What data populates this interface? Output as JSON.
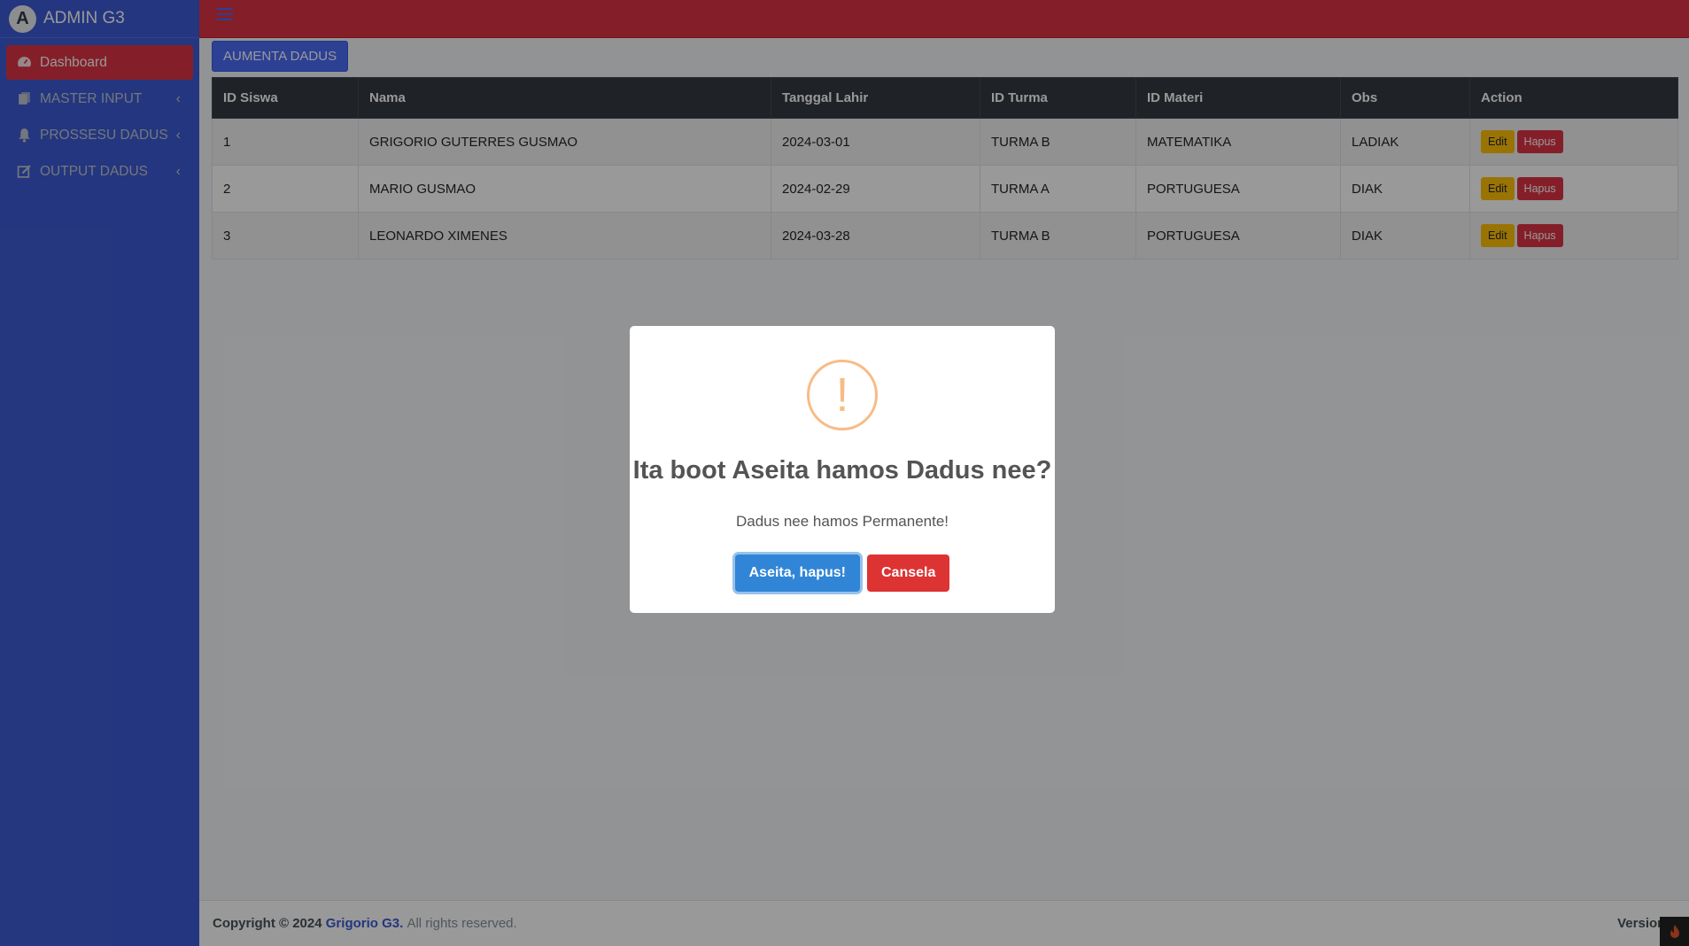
{
  "brand": {
    "title": "ADMIN G3",
    "logo_letter": "A"
  },
  "sidebar": {
    "items": [
      {
        "label": "Dashboard",
        "icon": "tachometer-icon"
      },
      {
        "label": "MASTER INPUT",
        "icon": "copy-icon",
        "chevron": "‹"
      },
      {
        "label": "PROSSESU DADUS",
        "icon": "bell-icon",
        "chevron": "‹"
      },
      {
        "label": "OUTPUT DADUS",
        "icon": "edit-icon",
        "chevron": "‹"
      }
    ]
  },
  "toolbar": {
    "add_label": "AUMENTA DADUS"
  },
  "table": {
    "headers": [
      "ID Siswa",
      "Nama",
      "Tanggal Lahir",
      "ID Turma",
      "ID Materi",
      "Obs",
      "Action"
    ],
    "rows": [
      [
        "1",
        "GRIGORIO GUTERRES GUSMAO",
        "2024-03-01",
        "TURMA B",
        "MATEMATIKA",
        "LADIAK"
      ],
      [
        "2",
        "MARIO GUSMAO",
        "2024-02-29",
        "TURMA A",
        "PORTUGUESA",
        "DIAK"
      ],
      [
        "3",
        "LEONARDO XIMENES",
        "2024-03-28",
        "TURMA B",
        "PORTUGUESA",
        "DIAK"
      ]
    ],
    "edit_label": "Edit",
    "delete_label": "Hapus"
  },
  "footer": {
    "copyright": "Copyright © 2024",
    "author": "Grigorio G3.",
    "rights": "All rights reserved.",
    "version": "Version 3."
  },
  "modal": {
    "icon_glyph": "!",
    "title": "Ita boot Aseita hamos Dadus nee?",
    "text": "Dadus nee hamos Permanente!",
    "confirm_label": "Aseita, hapus!",
    "cancel_label": "Cansela"
  },
  "colors": {
    "sidebar": "#3d5bd4",
    "topbar": "#dc3545",
    "primary": "#4a6cf7",
    "warning": "#ffc107",
    "danger": "#dc3545",
    "confirm": "#3085d6"
  }
}
